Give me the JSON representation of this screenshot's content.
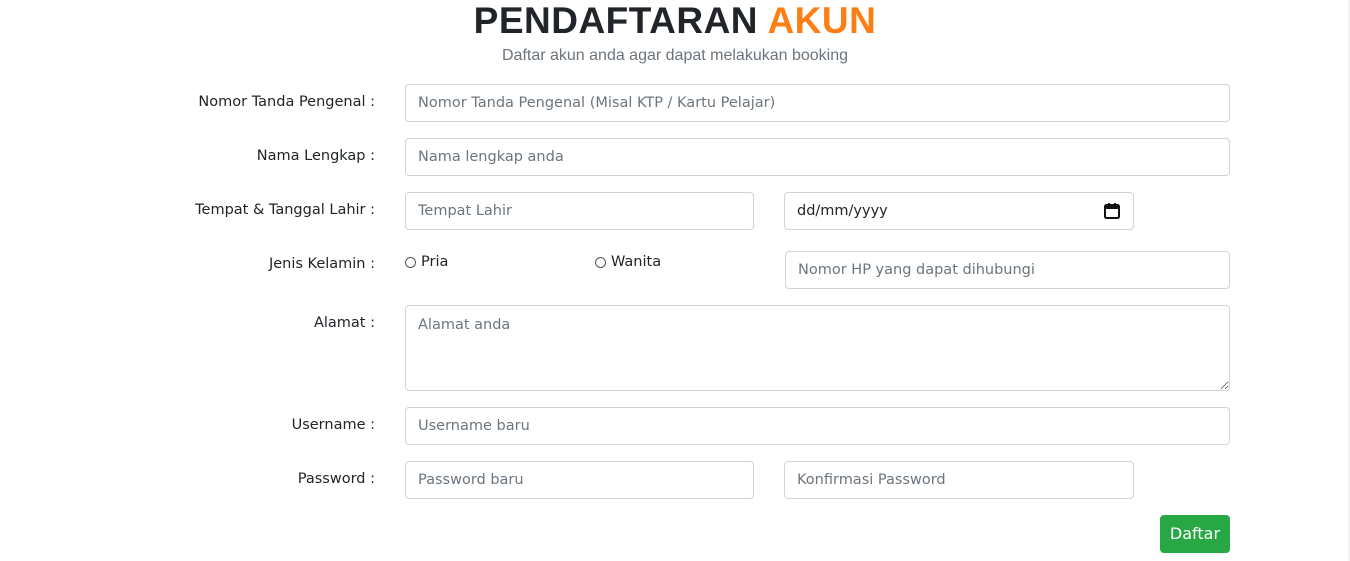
{
  "header": {
    "title_main": "PENDAFTARAN",
    "title_accent": "AKUN",
    "subtitle": "Daftar akun anda agar dapat melakukan booking",
    "accent_color": "#fd7e14"
  },
  "form": {
    "id_number": {
      "label": "Nomor Tanda Pengenal :",
      "placeholder": "Nomor Tanda Pengenal (Misal KTP / Kartu Pelajar)"
    },
    "full_name": {
      "label": "Nama Lengkap :",
      "placeholder": "Nama lengkap anda"
    },
    "birth": {
      "label": "Tempat & Tanggal Lahir :",
      "place_placeholder": "Tempat Lahir",
      "date_value": "dd/mm/yyyy",
      "date_icon": "calendar-icon"
    },
    "gender": {
      "label": "Jenis Kelamin :",
      "option_male": "Pria",
      "option_female": "Wanita",
      "phone_placeholder": "Nomor HP yang dapat dihubungi"
    },
    "address": {
      "label": "Alamat :",
      "placeholder": "Alamat anda"
    },
    "username": {
      "label": "Username :",
      "placeholder": "Username baru"
    },
    "password": {
      "label": "Password :",
      "placeholder": "Password baru",
      "confirm_placeholder": "Konfirmasi Password"
    },
    "submit_label": "Daftar",
    "submit_color": "#28a745"
  }
}
